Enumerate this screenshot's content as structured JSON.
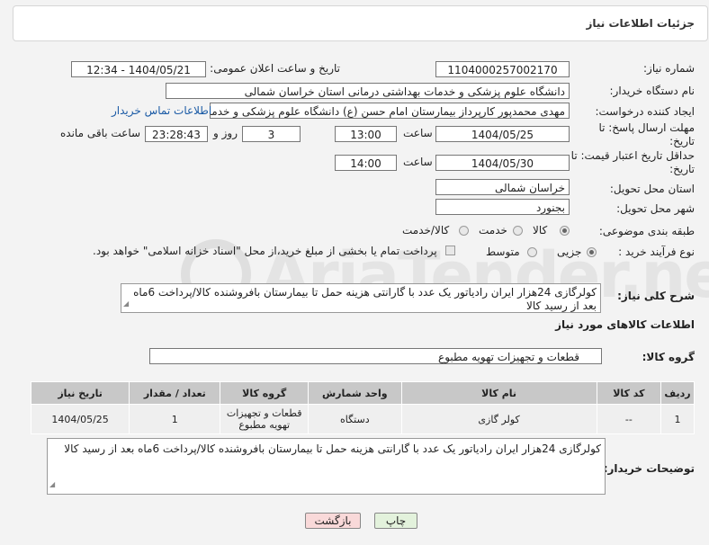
{
  "header": {
    "title": "جزئیات اطلاعات نیاز"
  },
  "watermark": {
    "text": "AriaTender.net"
  },
  "form": {
    "need_number_label": "شماره نیاز:",
    "need_number": "1104000257002170",
    "announce_label": "تاریخ و ساعت اعلان عمومی:",
    "announce_value": "1404/05/21 - 12:34",
    "buyer_org_label": "نام دستگاه خریدار:",
    "buyer_org": "دانشگاه علوم پزشکی و خدمات بهداشتی درمانی استان خراسان شمالی",
    "requester_label": "ایجاد کننده درخواست:",
    "requester": "مهدی محمدپور کارپرداز بیمارستان امام حسن (ع) دانشگاه علوم پزشکی و خدما",
    "contact_link": "اطلاعات تماس خریدار",
    "reply_deadline_label": "مهلت ارسال پاسخ: تا تاریخ:",
    "reply_date": "1404/05/25",
    "time_label": "ساعت",
    "reply_time": "13:00",
    "days_value": "3",
    "days_label": "روز و",
    "remaining_time": "23:28:43",
    "remaining_label": "ساعت باقی مانده",
    "price_validity_label": "حداقل تاریخ اعتبار قیمت: تا تاریخ:",
    "price_date": "1404/05/30",
    "price_time": "14:00",
    "delivery_province_label": "استان محل تحویل:",
    "delivery_province": "خراسان شمالی",
    "delivery_city_label": "شهر محل تحویل:",
    "delivery_city": "بجنورد",
    "category_label": "طبقه بندی موضوعی:",
    "category_options": [
      "کالا",
      "خدمت",
      "کالا/خدمت"
    ],
    "process_label": "نوع فرآیند خرید :",
    "process_options": [
      "جزیی",
      "متوسط"
    ],
    "payment_note": "پرداخت تمام یا بخشی از مبلغ خرید،از محل \"اسناد خزانه اسلامی\" خواهد بود.",
    "summary_label": "شرح کلی نیاز:",
    "summary": "کولرگازی 24هزار ایران رادیاتور یک عدد با گارانتی هزینه حمل تا بیمارستان بافروشنده کالا/پرداخت 6ماه بعد از رسید کالا"
  },
  "goods": {
    "section_title": "اطلاعات کالاهای مورد نیاز",
    "group_label": "گروه کالا:",
    "group_value": "قطعات و تجهیزات تهویه مطبوع",
    "columns": [
      "ردیف",
      "کد کالا",
      "نام کالا",
      "واحد شمارش",
      "گروه کالا",
      "تعداد / مقدار",
      "تاریخ نیاز"
    ],
    "rows": [
      [
        "1",
        "--",
        "کولر گازی",
        "دستگاه",
        "قطعات و تجهیزات تهویه مطبوع",
        "1",
        "1404/05/25"
      ]
    ]
  },
  "buyer_notes": {
    "label": "توضیحات خریدار:",
    "text": "کولرگازی 24هزار ایران رادیاتور یک عدد با گارانتی هزینه حمل تا بیمارستان بافروشنده کالا/پرداخت 6ماه بعد از رسید کالا"
  },
  "buttons": {
    "print": "چاپ",
    "back": "بازگشت"
  },
  "colors": {
    "back_button": "#f9d9d9",
    "print_button": "#e3f2dc",
    "table_header": "#c8c8c8",
    "link": "#1a5aa5"
  }
}
